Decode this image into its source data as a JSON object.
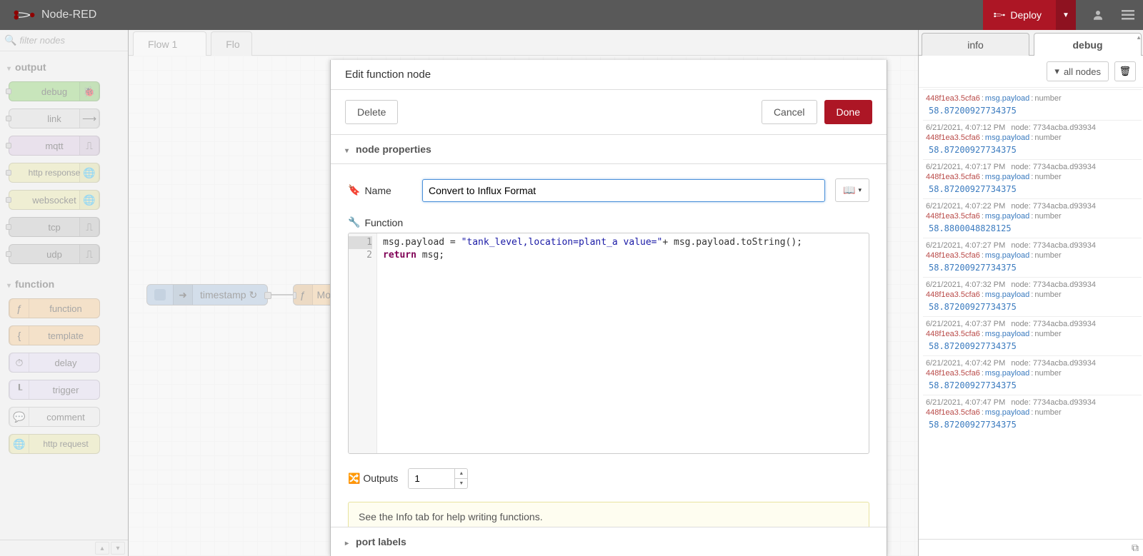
{
  "app": {
    "title": "Node-RED"
  },
  "header": {
    "deploy_label": "Deploy"
  },
  "palette": {
    "filter_placeholder": "filter nodes",
    "cat_output": "output",
    "cat_function": "function",
    "nodes_output": [
      "debug",
      "link",
      "mqtt",
      "http response",
      "websocket",
      "tcp",
      "udp"
    ],
    "nodes_function": [
      "function",
      "template",
      "delay",
      "trigger",
      "comment",
      "http request"
    ]
  },
  "workspace": {
    "tab1": "Flow 1",
    "tab2": "Flo",
    "flow_node_1": "timestamp ↻",
    "flow_node_2": "Mo"
  },
  "dialog": {
    "title": "Edit function node",
    "btn_delete": "Delete",
    "btn_cancel": "Cancel",
    "btn_done": "Done",
    "section_node_props": "node properties",
    "section_port_labels": "port labels",
    "label_name": "Name",
    "value_name": "Convert to Influx Format",
    "label_function": "Function",
    "label_outputs": "Outputs",
    "value_outputs": "1",
    "hint": "See the Info tab for help writing functions.",
    "code_line1_a": "msg.payload = ",
    "code_line1_str": "\"tank_level,location=plant_a value=\"",
    "code_line1_b": "+ msg.payload.toString();",
    "code_line2_kw": "return",
    "code_line2_rest": " msg;",
    "gutter1": "1",
    "gutter2": "2"
  },
  "sidebar": {
    "tab_info": "info",
    "tab_debug": "debug",
    "btn_all_nodes": "all nodes"
  },
  "debug_header": {
    "msg_id": "448f1ea3.5cfa6",
    "payload": "msg.payload",
    "type": "number"
  },
  "debug": [
    {
      "time": "",
      "node": "",
      "value": "58.87200927734375"
    },
    {
      "time": "6/21/2021, 4:07:12 PM",
      "node": "node: 7734acba.d93934",
      "value": "58.87200927734375"
    },
    {
      "time": "6/21/2021, 4:07:17 PM",
      "node": "node: 7734acba.d93934",
      "value": "58.87200927734375"
    },
    {
      "time": "6/21/2021, 4:07:22 PM",
      "node": "node: 7734acba.d93934",
      "value": "58.8800048828125"
    },
    {
      "time": "6/21/2021, 4:07:27 PM",
      "node": "node: 7734acba.d93934",
      "value": "58.87200927734375"
    },
    {
      "time": "6/21/2021, 4:07:32 PM",
      "node": "node: 7734acba.d93934",
      "value": "58.87200927734375"
    },
    {
      "time": "6/21/2021, 4:07:37 PM",
      "node": "node: 7734acba.d93934",
      "value": "58.87200927734375"
    },
    {
      "time": "6/21/2021, 4:07:42 PM",
      "node": "node: 7734acba.d93934",
      "value": "58.87200927734375"
    },
    {
      "time": "6/21/2021, 4:07:47 PM",
      "node": "node: 7734acba.d93934",
      "value": "58.87200927734375"
    }
  ],
  "colors": {
    "debug_node": "#87d068",
    "link_node": "#dddddd",
    "mqtt_node": "#d9c6e0",
    "http_node": "#e8e7a3",
    "ws_node": "#e8e7a3",
    "tcp_node": "#c0c0c0",
    "udp_node": "#c0c0c0",
    "func_node": "#f5c589",
    "tmpl_node": "#f5c589",
    "delay_node": "#e2d9f3",
    "trig_node": "#e2d9f3",
    "cmnt_node": "#ececec",
    "req_node": "#e8e7a3"
  }
}
